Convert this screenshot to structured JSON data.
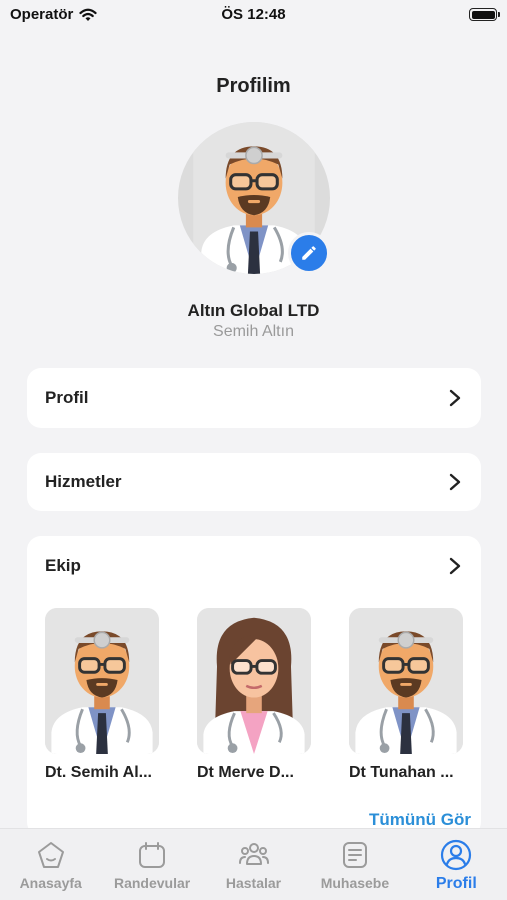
{
  "status_bar": {
    "carrier": "Operatör",
    "time": "ÖS 12:48"
  },
  "page": {
    "title": "Profilim"
  },
  "profile": {
    "company": "Altın Global LTD",
    "name": "Semih Altın"
  },
  "menu": {
    "profile_label": "Profil",
    "services_label": "Hizmetler",
    "team_label": "Ekip",
    "see_all_label": "Tümünü Gör"
  },
  "team": [
    {
      "name": "Dt. Semih Al...",
      "avatar": "male-doctor"
    },
    {
      "name": "Dt Merve D...",
      "avatar": "female-doctor"
    },
    {
      "name": "Dt Tunahan ...",
      "avatar": "male-doctor"
    }
  ],
  "tabs": [
    {
      "label": "Anasayfa",
      "icon": "home-icon",
      "active": false
    },
    {
      "label": "Randevular",
      "icon": "calendar-icon",
      "active": false
    },
    {
      "label": "Hastalar",
      "icon": "users-icon",
      "active": false
    },
    {
      "label": "Muhasebe",
      "icon": "document-icon",
      "active": false
    },
    {
      "label": "Profil",
      "icon": "profile-icon",
      "active": true
    }
  ],
  "colors": {
    "accent": "#2b7de9",
    "link": "#2b8fd8",
    "background": "#f3f3f5"
  }
}
